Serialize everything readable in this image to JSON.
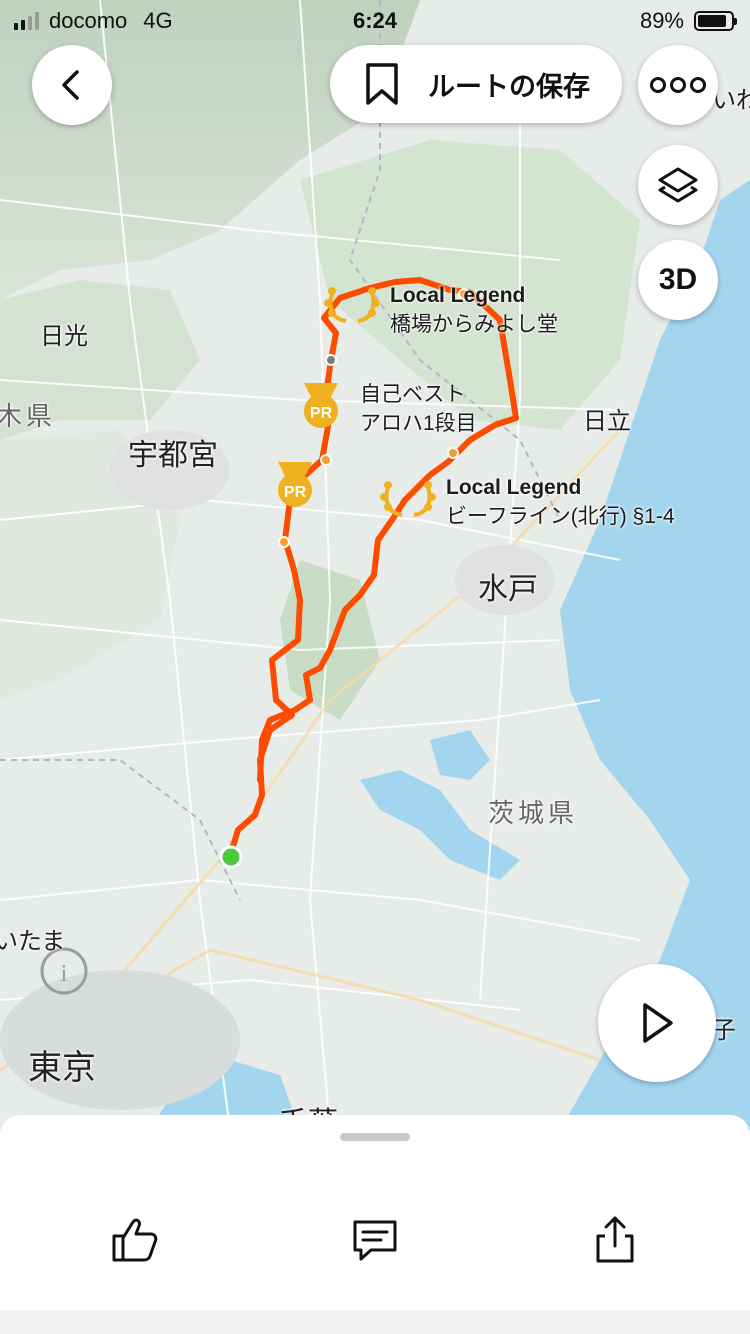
{
  "status": {
    "carrier": "docomo",
    "network": "4G",
    "time": "6:24",
    "battery": "89%",
    "battery_level": 0.89
  },
  "toolbar": {
    "save_label": "ルートの保存",
    "view_3d_label": "3D"
  },
  "icons": {
    "back": "chevron-left-icon",
    "bookmark": "bookmark-icon",
    "more": "more-icon",
    "layers": "layers-icon",
    "play": "play-icon",
    "like": "thumbs-up-icon",
    "comment": "comment-icon",
    "share": "share-icon"
  },
  "colors": {
    "route": "#fc4c02",
    "start": "#4cc93b",
    "pr_badge": "#f0b120",
    "legend_badge": "#f0b120",
    "water": "#a4d5ef"
  },
  "map": {
    "labels": {
      "nikko": "日光",
      "tochigi_fragment": "木県",
      "utsunomiya": "宇都宮",
      "hitachi": "日立",
      "mito": "水戸",
      "ibaraki": "茨城県",
      "saitama_fragment": "いたま",
      "tokyo": "東京",
      "chiba_fragment": "千葉",
      "iwaki_fragment": "いわ",
      "choshi_fragment": "子"
    },
    "annotations": [
      {
        "title": "Local Legend",
        "subtitle": "橋場からみよし堂"
      },
      {
        "title": "自己ベスト",
        "subtitle": "アロハ1段目"
      },
      {
        "title": "Local Legend",
        "subtitle": "ビーフライン(北行) §1-4"
      }
    ],
    "pr_badge_label": "PR"
  }
}
